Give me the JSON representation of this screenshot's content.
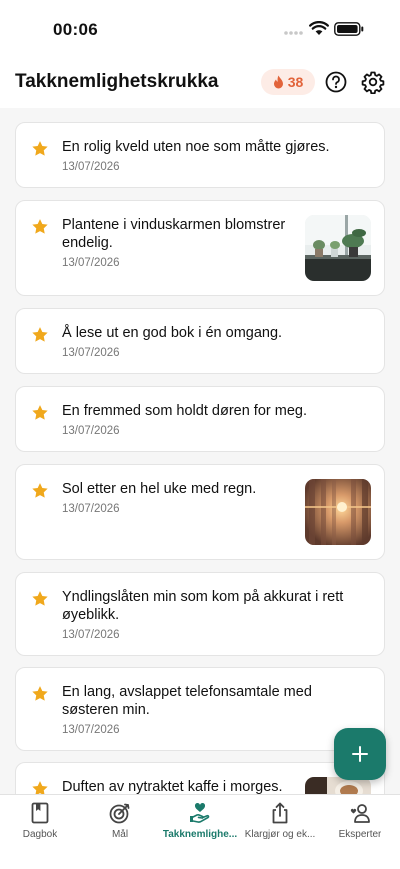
{
  "status_bar": {
    "time": "00:06"
  },
  "header": {
    "title": "Takknemlighetskrukka",
    "streak_count": "38"
  },
  "entries": [
    {
      "text": "En rolig kveld uten noe som måtte gjøres.",
      "date": "13/07/2026",
      "has_image": false
    },
    {
      "text": "Plantene i vinduskarmen blomstrer endelig.",
      "date": "13/07/2026",
      "has_image": true
    },
    {
      "text": "Å lese ut en god bok i én omgang.",
      "date": "13/07/2026",
      "has_image": false
    },
    {
      "text": "En fremmed som holdt døren for meg.",
      "date": "13/07/2026",
      "has_image": false
    },
    {
      "text": "Sol etter en hel uke med regn.",
      "date": "13/07/2026",
      "has_image": true
    },
    {
      "text": "Yndlingslåten min som kom på akkurat i rett øyeblikk.",
      "date": "13/07/2026",
      "has_image": false
    },
    {
      "text": "En lang, avslappet telefonsamtale med søsteren min.",
      "date": "13/07/2026",
      "has_image": false
    },
    {
      "text": "Duften av nytraktet kaffe i morges.",
      "date": "",
      "has_image": true
    }
  ],
  "tabs": [
    {
      "label": "Dagbok",
      "icon": "journal-icon"
    },
    {
      "label": "Mål",
      "icon": "target-icon"
    },
    {
      "label": "Takknemlighe...",
      "icon": "gratitude-hand-icon",
      "active": true
    },
    {
      "label": "Klargjør og ek...",
      "icon": "share-icon"
    },
    {
      "label": "Eksperter",
      "icon": "experts-icon"
    }
  ],
  "colors": {
    "accent": "#1b7a6b",
    "star": "#f0a81c",
    "streak": "#e2643b"
  }
}
